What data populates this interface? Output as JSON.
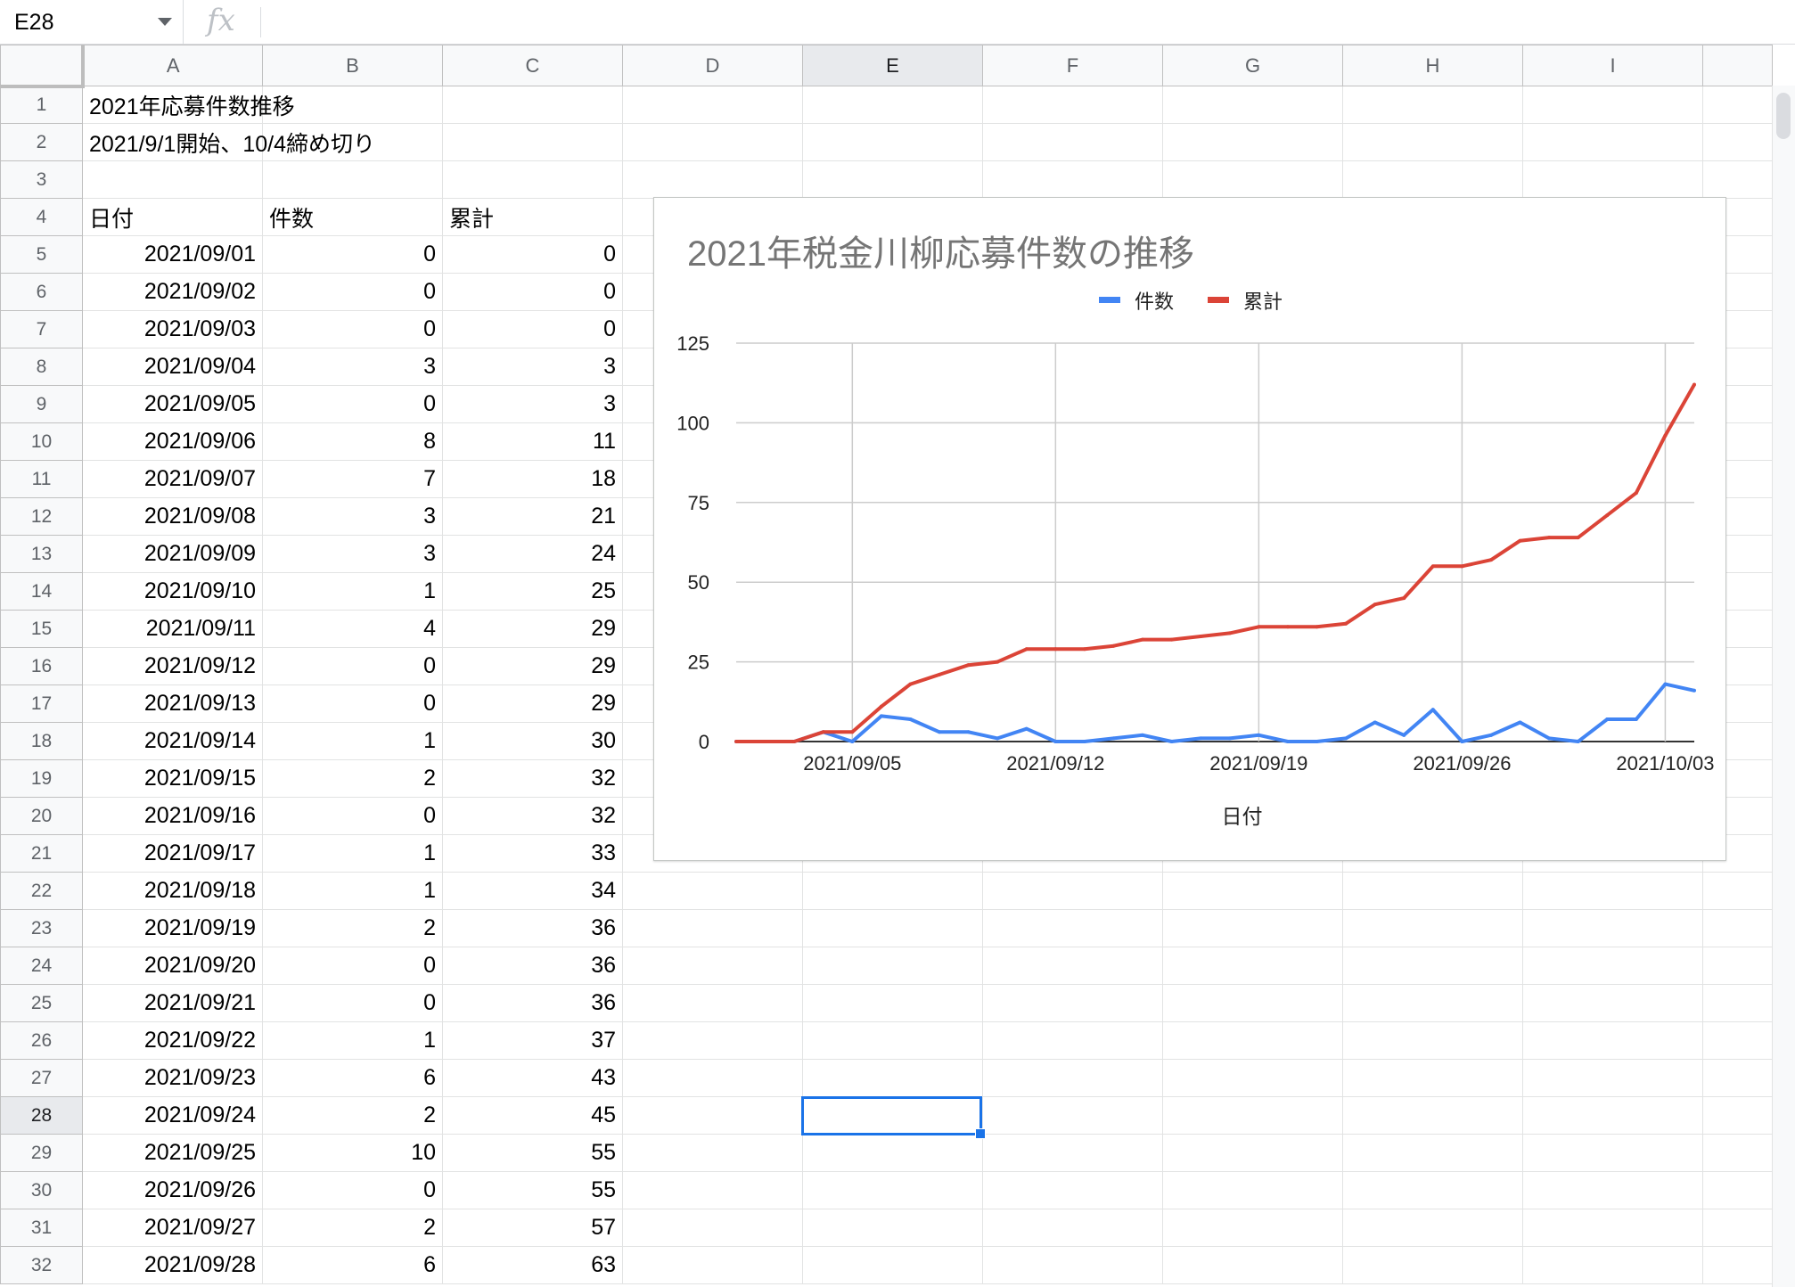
{
  "formula_bar": {
    "name_box": "E28",
    "fx_label": "fx",
    "formula": ""
  },
  "columns": [
    "A",
    "B",
    "C",
    "D",
    "E",
    "F",
    "G",
    "H",
    "I"
  ],
  "active_column": "E",
  "active_row": 28,
  "active_cell": "E28",
  "rows": [
    {
      "n": 1,
      "a": "2021年応募件数推移",
      "b": "",
      "c": ""
    },
    {
      "n": 2,
      "a": "2021/9/1開始、10/4締め切り",
      "b": "",
      "c": ""
    },
    {
      "n": 3,
      "a": "",
      "b": "",
      "c": ""
    },
    {
      "n": 4,
      "a": "日付",
      "b": "件数",
      "c": "累計",
      "header": true
    },
    {
      "n": 5,
      "a": "2021/09/01",
      "b": "0",
      "c": "0"
    },
    {
      "n": 6,
      "a": "2021/09/02",
      "b": "0",
      "c": "0"
    },
    {
      "n": 7,
      "a": "2021/09/03",
      "b": "0",
      "c": "0"
    },
    {
      "n": 8,
      "a": "2021/09/04",
      "b": "3",
      "c": "3"
    },
    {
      "n": 9,
      "a": "2021/09/05",
      "b": "0",
      "c": "3"
    },
    {
      "n": 10,
      "a": "2021/09/06",
      "b": "8",
      "c": "11"
    },
    {
      "n": 11,
      "a": "2021/09/07",
      "b": "7",
      "c": "18"
    },
    {
      "n": 12,
      "a": "2021/09/08",
      "b": "3",
      "c": "21"
    },
    {
      "n": 13,
      "a": "2021/09/09",
      "b": "3",
      "c": "24"
    },
    {
      "n": 14,
      "a": "2021/09/10",
      "b": "1",
      "c": "25"
    },
    {
      "n": 15,
      "a": "2021/09/11",
      "b": "4",
      "c": "29"
    },
    {
      "n": 16,
      "a": "2021/09/12",
      "b": "0",
      "c": "29"
    },
    {
      "n": 17,
      "a": "2021/09/13",
      "b": "0",
      "c": "29"
    },
    {
      "n": 18,
      "a": "2021/09/14",
      "b": "1",
      "c": "30"
    },
    {
      "n": 19,
      "a": "2021/09/15",
      "b": "2",
      "c": "32"
    },
    {
      "n": 20,
      "a": "2021/09/16",
      "b": "0",
      "c": "32"
    },
    {
      "n": 21,
      "a": "2021/09/17",
      "b": "1",
      "c": "33"
    },
    {
      "n": 22,
      "a": "2021/09/18",
      "b": "1",
      "c": "34"
    },
    {
      "n": 23,
      "a": "2021/09/19",
      "b": "2",
      "c": "36"
    },
    {
      "n": 24,
      "a": "2021/09/20",
      "b": "0",
      "c": "36"
    },
    {
      "n": 25,
      "a": "2021/09/21",
      "b": "0",
      "c": "36"
    },
    {
      "n": 26,
      "a": "2021/09/22",
      "b": "1",
      "c": "37"
    },
    {
      "n": 27,
      "a": "2021/09/23",
      "b": "6",
      "c": "43"
    },
    {
      "n": 28,
      "a": "2021/09/24",
      "b": "2",
      "c": "45"
    },
    {
      "n": 29,
      "a": "2021/09/25",
      "b": "10",
      "c": "55"
    },
    {
      "n": 30,
      "a": "2021/09/26",
      "b": "0",
      "c": "55"
    },
    {
      "n": 31,
      "a": "2021/09/27",
      "b": "2",
      "c": "57"
    },
    {
      "n": 32,
      "a": "2021/09/28",
      "b": "6",
      "c": "63"
    }
  ],
  "chart_data": {
    "type": "line",
    "title": "2021年税金川柳応募件数の推移",
    "xlabel": "日付",
    "ylabel": "",
    "ylim": [
      0,
      125
    ],
    "yticks": [
      0,
      25,
      50,
      75,
      100,
      125
    ],
    "xtick_labels": [
      "2021/09/05",
      "2021/09/12",
      "2021/09/19",
      "2021/09/26",
      "2021/10/03"
    ],
    "grid": true,
    "legend_position": "top",
    "x": [
      "2021/09/01",
      "2021/09/02",
      "2021/09/03",
      "2021/09/04",
      "2021/09/05",
      "2021/09/06",
      "2021/09/07",
      "2021/09/08",
      "2021/09/09",
      "2021/09/10",
      "2021/09/11",
      "2021/09/12",
      "2021/09/13",
      "2021/09/14",
      "2021/09/15",
      "2021/09/16",
      "2021/09/17",
      "2021/09/18",
      "2021/09/19",
      "2021/09/20",
      "2021/09/21",
      "2021/09/22",
      "2021/09/23",
      "2021/09/24",
      "2021/09/25",
      "2021/09/26",
      "2021/09/27",
      "2021/09/28",
      "2021/09/29",
      "2021/09/30",
      "2021/10/01",
      "2021/10/02",
      "2021/10/03",
      "2021/10/04"
    ],
    "series": [
      {
        "name": "件数",
        "color": "#4285f4",
        "values": [
          0,
          0,
          0,
          3,
          0,
          8,
          7,
          3,
          3,
          1,
          4,
          0,
          0,
          1,
          2,
          0,
          1,
          1,
          2,
          0,
          0,
          1,
          6,
          2,
          10,
          0,
          2,
          6,
          1,
          0,
          7,
          7,
          18,
          16
        ]
      },
      {
        "name": "累計",
        "color": "#db4437",
        "values": [
          0,
          0,
          0,
          3,
          3,
          11,
          18,
          21,
          24,
          25,
          29,
          29,
          29,
          30,
          32,
          32,
          33,
          34,
          36,
          36,
          36,
          37,
          43,
          45,
          55,
          55,
          57,
          63,
          64,
          64,
          71,
          78,
          96,
          112
        ]
      }
    ]
  }
}
